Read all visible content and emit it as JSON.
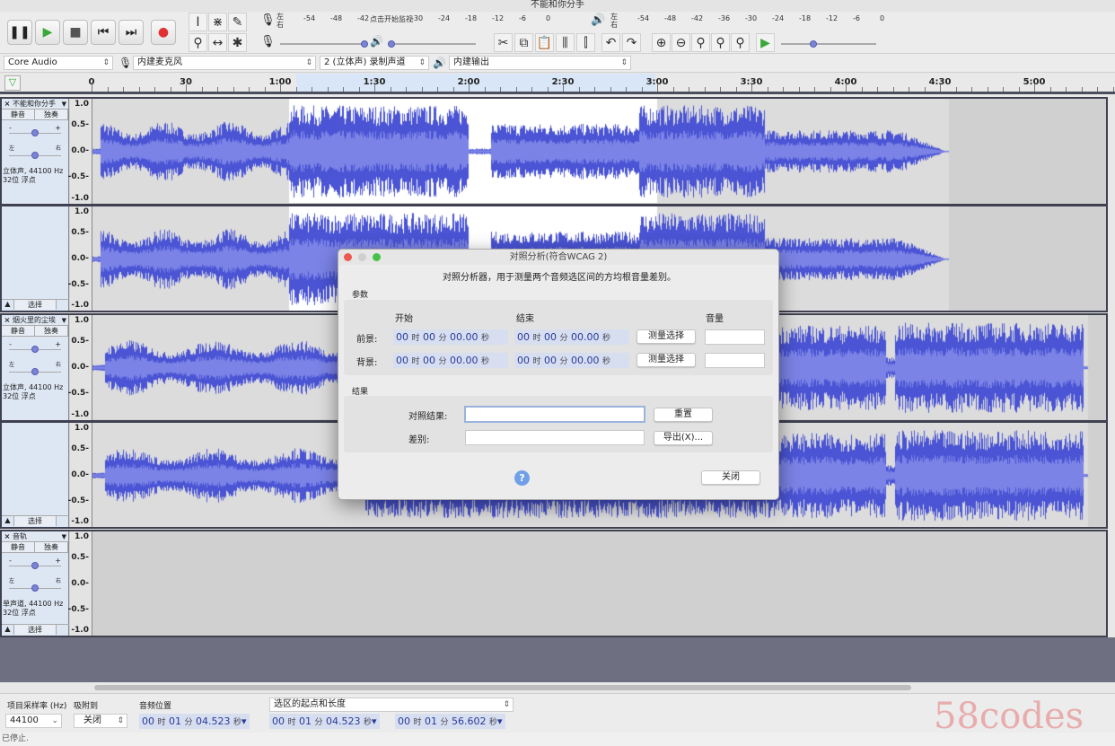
{
  "window": {
    "title": "不能和你分手"
  },
  "transport": [
    {
      "name": "pause-button",
      "icon": "pause-icon",
      "glyph": "❚❚",
      "color": "#222"
    },
    {
      "name": "play-button",
      "icon": "play-icon",
      "glyph": "▶",
      "color": "#3aa83a"
    },
    {
      "name": "stop-button",
      "icon": "stop-icon",
      "glyph": "■",
      "color": "#555"
    },
    {
      "name": "skip-start-button",
      "icon": "skip-start-icon",
      "glyph": "⏮",
      "color": "#222"
    },
    {
      "name": "skip-end-button",
      "icon": "skip-end-icon",
      "glyph": "⏭",
      "color": "#222"
    },
    {
      "name": "record-button",
      "icon": "record-icon",
      "glyph": "●",
      "color": "#e03030"
    }
  ],
  "tools": [
    {
      "name": "selection-tool",
      "glyph": "I"
    },
    {
      "name": "envelope-tool",
      "glyph": "⋇"
    },
    {
      "name": "draw-tool",
      "glyph": "✎"
    },
    {
      "name": "zoom-tool",
      "glyph": "⚲"
    },
    {
      "name": "time-shift-tool",
      "glyph": "↔"
    },
    {
      "name": "multi-tool",
      "glyph": "✱"
    }
  ],
  "meters": {
    "lr_top": "左",
    "lr_bottom": "右",
    "ticks": [
      "-54",
      "-48",
      "-42",
      "-36",
      "-30",
      "-24",
      "-18",
      "-12",
      "-6",
      "0"
    ],
    "record_prompt": "点击开始监视"
  },
  "edit_tools": [
    {
      "name": "cut-button",
      "glyph": "✂"
    },
    {
      "name": "copy-button",
      "glyph": "⧉"
    },
    {
      "name": "paste-button",
      "glyph": "📋"
    },
    {
      "name": "trim-button",
      "glyph": "⫼"
    },
    {
      "name": "silence-button",
      "glyph": "⫿"
    }
  ],
  "history": [
    {
      "name": "undo-button",
      "glyph": "↶"
    },
    {
      "name": "redo-button",
      "glyph": "↷"
    }
  ],
  "zoom_tools": [
    {
      "name": "zoom-in-button",
      "glyph": "⊕"
    },
    {
      "name": "zoom-out-button",
      "glyph": "⊖"
    },
    {
      "name": "fit-selection-button",
      "glyph": "⚲"
    },
    {
      "name": "fit-project-button",
      "glyph": "⚲"
    },
    {
      "name": "zoom-toggle-button",
      "glyph": "⚲"
    }
  ],
  "devices": {
    "host": "Core Audio",
    "input": "内建麦克风",
    "channels": "2 (立体声) 录制声道",
    "output": "内建输出"
  },
  "ruler": {
    "labels": [
      "0",
      "30",
      "1:00",
      "1:30",
      "2:00",
      "2:30",
      "3:00",
      "3:30",
      "4:00",
      "4:30",
      "5:00"
    ]
  },
  "colors": {
    "waveform": "#4a54d4",
    "waveform_rms": "#7b83e6",
    "selection": "#ffffff",
    "accent": "#7a84d6"
  },
  "scale_labels": [
    "1.0",
    "0.5-",
    "0.0-",
    "-0.5-",
    "-1.0"
  ],
  "tracks": [
    {
      "name": "不能和你分手",
      "mute": "静音",
      "solo": "独奏",
      "pan_l": "左",
      "pan_r": "右",
      "format1": "立体声, 44100 Hz",
      "format2": "32位 浮点",
      "select": "选择"
    },
    {
      "name": "烟火里的尘埃",
      "mute": "静音",
      "solo": "独奏",
      "pan_l": "左",
      "pan_r": "右",
      "format1": "立体声, 44100 Hz",
      "format2": "32位 浮点",
      "select": "选择"
    },
    {
      "name": "音轨",
      "mute": "静音",
      "solo": "独奏",
      "pan_l": "左",
      "pan_r": "右",
      "format1": "单声道, 44100 Hz",
      "format2": "32位 浮点",
      "select": "选择"
    }
  ],
  "bottom": {
    "rate_label": "项目采样率 (Hz)",
    "rate_value": "44100",
    "snap_label": "吸附到",
    "snap_value": "关闭",
    "pos_label": "音频位置",
    "pos_value": {
      "h": "00",
      "m": "01",
      "s": "04.523"
    },
    "sel_mode": "选区的起点和长度",
    "sel_start": {
      "h": "00",
      "m": "01",
      "s": "04.523"
    },
    "sel_len": {
      "h": "00",
      "m": "01",
      "s": "56.602"
    },
    "u_h": "时",
    "u_m": "分",
    "u_s": "秒"
  },
  "status": "已停止.",
  "dialog": {
    "title": "对照分析(符合WCAG 2)",
    "description": "对照分析器，用于测量两个音频选区间的方均根音量差别。",
    "params_label": "参数",
    "col_start": "开始",
    "col_end": "结束",
    "col_volume": "音量",
    "foreground": "前景:",
    "background": "背景:",
    "fg_start": "00",
    "fg_end": "00",
    "time_value": {
      "h": "00",
      "m": "00",
      "s": "00.00"
    },
    "measure": "测量选择",
    "fg_volume": "",
    "bg_volume": "",
    "results_label": "结果",
    "contrast_label": "对照结果:",
    "contrast_value": "",
    "diff_label": "差别:",
    "diff_value": "",
    "reset": "重置",
    "export": "导出(X)...",
    "close": "关闭",
    "help": "?"
  },
  "watermark": "58codes"
}
